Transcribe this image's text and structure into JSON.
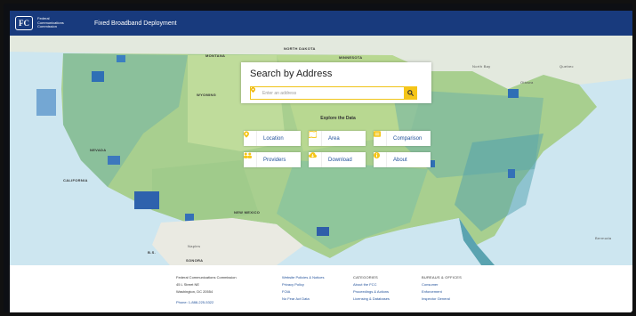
{
  "header": {
    "logo_text": "FC",
    "agency_lines": [
      "Federal",
      "Communications",
      "Commission"
    ],
    "app_title": "Fixed Broadband Deployment"
  },
  "search": {
    "title": "Search by Address",
    "placeholder": "Enter an address"
  },
  "explore": {
    "heading": "Explore the Data",
    "tiles": [
      {
        "label": "Location",
        "icon": "location-pin-icon"
      },
      {
        "label": "Area",
        "icon": "map-area-icon"
      },
      {
        "label": "Comparison",
        "icon": "comparison-icon"
      },
      {
        "label": "Providers",
        "icon": "providers-icon"
      },
      {
        "label": "Download",
        "icon": "download-cloud-icon"
      },
      {
        "label": "About",
        "icon": "info-icon"
      }
    ]
  },
  "map_labels": [
    "MONTANA",
    "NORTH DAKOTA",
    "MINNESOTA",
    "WYOMING",
    "NEVADA",
    "CALIFORNIA",
    "NEW MEXICO",
    "North Bay",
    "Ottawa",
    "Quebec",
    "Bermuda",
    "Naples",
    "SONORA",
    "B.S."
  ],
  "colors": {
    "header": "#183a7d",
    "accent": "#f5c518",
    "link": "#1f4f99"
  },
  "footer": {
    "contact": [
      "Federal Communications Commission",
      "45 L Street NE",
      "Washington, DC 20554"
    ],
    "phone": "Phone: 1-888-225-5322",
    "col2": [
      "Website Policies & Notices",
      "Privacy Policy",
      "FOIA",
      "No Fear Act Data"
    ],
    "col3_header": "CATEGORIES",
    "col3": [
      "About the FCC",
      "Proceedings & Actions",
      "Licensing & Databases"
    ],
    "col4_header": "BUREAUS & OFFICES",
    "col4": [
      "Consumer",
      "Enforcement",
      "Inspector General"
    ]
  }
}
